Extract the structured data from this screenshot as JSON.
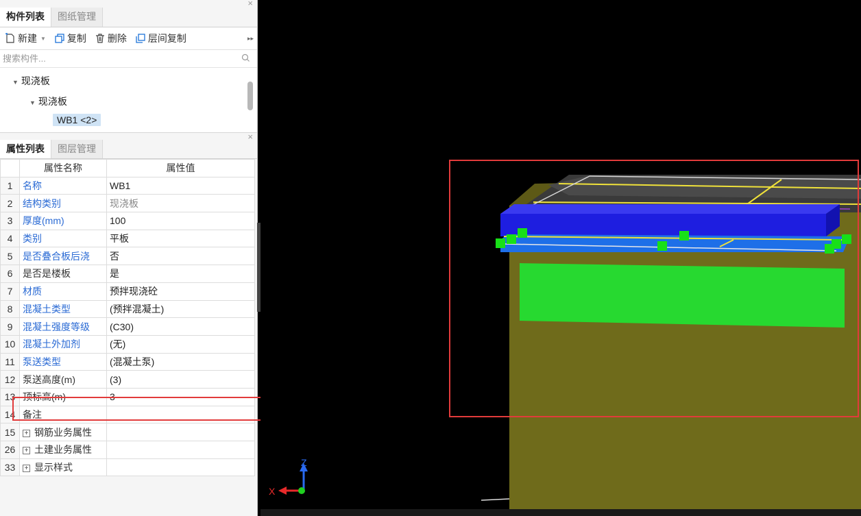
{
  "panel_top": {
    "tabs": [
      "构件列表",
      "图纸管理"
    ],
    "close_symbol": "×",
    "toolbar": {
      "new": "新建",
      "copy": "复制",
      "delete": "删除",
      "floor_copy": "层间复制",
      "more": "▸▸"
    },
    "search_placeholder": "搜索构件...",
    "tree": {
      "root": "现浇板",
      "child": "现浇板",
      "item": "WB1 <2>"
    }
  },
  "panel_props": {
    "tabs": [
      "属性列表",
      "图层管理"
    ],
    "close_symbol": "×",
    "headers": [
      "属性名称",
      "属性值"
    ],
    "rows": [
      {
        "n": "1",
        "name": "名称",
        "value": "WB1"
      },
      {
        "n": "2",
        "name": "结构类别",
        "value": "现浇板"
      },
      {
        "n": "3",
        "name": "厚度(mm)",
        "value": "100"
      },
      {
        "n": "4",
        "name": "类别",
        "value": "平板"
      },
      {
        "n": "5",
        "name": "是否叠合板后浇",
        "value": "否"
      },
      {
        "n": "6",
        "name": "是否是楼板",
        "value": "是"
      },
      {
        "n": "7",
        "name": "材质",
        "value": "预拌现浇砼"
      },
      {
        "n": "8",
        "name": "混凝土类型",
        "value": "(预拌混凝土)"
      },
      {
        "n": "9",
        "name": "混凝土强度等级",
        "value": "(C30)"
      },
      {
        "n": "10",
        "name": "混凝土外加剂",
        "value": "(无)"
      },
      {
        "n": "11",
        "name": "泵送类型",
        "value": "(混凝土泵)"
      },
      {
        "n": "12",
        "name": "泵送高度(m)",
        "value": "(3)"
      },
      {
        "n": "13",
        "name": "顶标高(m)",
        "value": "3"
      },
      {
        "n": "14",
        "name": "备注",
        "value": ""
      },
      {
        "n": "15",
        "name": "钢筋业务属性",
        "value": ""
      },
      {
        "n": "26",
        "name": "土建业务属性",
        "value": ""
      },
      {
        "n": "33",
        "name": "显示样式",
        "value": ""
      }
    ]
  },
  "axis": {
    "z": "Z",
    "x": "X"
  }
}
